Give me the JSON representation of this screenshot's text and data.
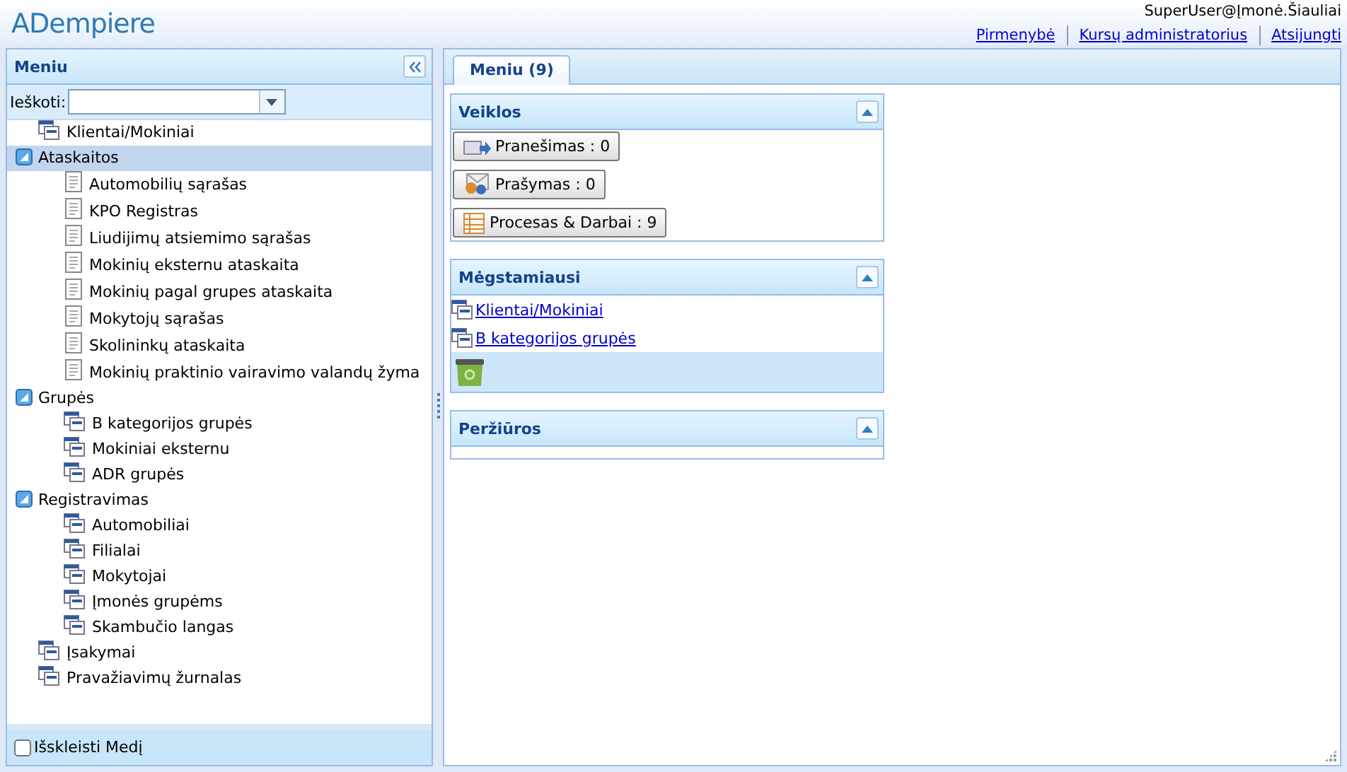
{
  "header": {
    "logo": "ADempiere",
    "user": "SuperUser@Įmonė.Šiauliai",
    "links": [
      "Pirmenybė",
      "Kursų administratorius",
      "Atsijungti"
    ]
  },
  "menu_panel": {
    "title": "Meniu",
    "search_label": "Ieškoti:",
    "tree": [
      {
        "kind": "window",
        "label": "Klientai/Mokiniai",
        "selected": false
      },
      {
        "kind": "folder",
        "label": "Ataskaitos",
        "expanded": true,
        "selected": true,
        "children": [
          {
            "kind": "report",
            "label": "Automobilių sąrašas",
            "selected": false
          },
          {
            "kind": "report",
            "label": "KPO Registras",
            "selected": false
          },
          {
            "kind": "report",
            "label": "Liudijimų atsiemimo sąrašas",
            "selected": false
          },
          {
            "kind": "report",
            "label": "Mokinių eksternu ataskaita",
            "selected": false
          },
          {
            "kind": "report",
            "label": "Mokinių pagal grupes ataskaita",
            "selected": false
          },
          {
            "kind": "report",
            "label": "Mokytojų sąrašas",
            "selected": false
          },
          {
            "kind": "report",
            "label": "Skolininkų ataskaita",
            "selected": false
          },
          {
            "kind": "report",
            "label": "Mokinių praktinio vairavimo valandų žyma",
            "selected": false
          }
        ]
      },
      {
        "kind": "folder",
        "label": "Grupės",
        "expanded": true,
        "selected": false,
        "children": [
          {
            "kind": "window",
            "label": "B kategorijos grupės",
            "selected": false
          },
          {
            "kind": "window",
            "label": "Mokiniai eksternu",
            "selected": false
          },
          {
            "kind": "window",
            "label": "ADR grupės",
            "selected": false
          }
        ]
      },
      {
        "kind": "folder",
        "label": "Registravimas",
        "expanded": true,
        "selected": false,
        "children": [
          {
            "kind": "window",
            "label": "Automobiliai",
            "selected": false
          },
          {
            "kind": "window",
            "label": "Filialai",
            "selected": false
          },
          {
            "kind": "window",
            "label": "Mokytojai",
            "selected": false
          },
          {
            "kind": "window",
            "label": "Įmonės grupėms",
            "selected": false
          },
          {
            "kind": "window",
            "label": "Skambučio langas",
            "selected": false
          }
        ]
      },
      {
        "kind": "window",
        "label": "Įsakymai",
        "selected": false
      },
      {
        "kind": "window",
        "label": "Pravažiavimų žurnalas",
        "selected": false
      }
    ],
    "expand_tree": {
      "label": "Išskleisti Medį",
      "checked": false
    }
  },
  "tabs": [
    {
      "label": "Meniu (9)",
      "selected": true
    }
  ],
  "portlets": [
    {
      "kind": "activities",
      "title": "Veiklos",
      "buttons": [
        {
          "label": "Pranešimas : 0"
        },
        {
          "label": "Prašymas : 0"
        },
        {
          "label": "Procesas & Darbai : 9"
        }
      ]
    },
    {
      "kind": "favorites",
      "title": "Mėgstamiausi",
      "links": [
        "Klientai/Mokiniai",
        "B kategorijos grupės"
      ]
    },
    {
      "kind": "views",
      "title": "Peržiūros"
    }
  ]
}
